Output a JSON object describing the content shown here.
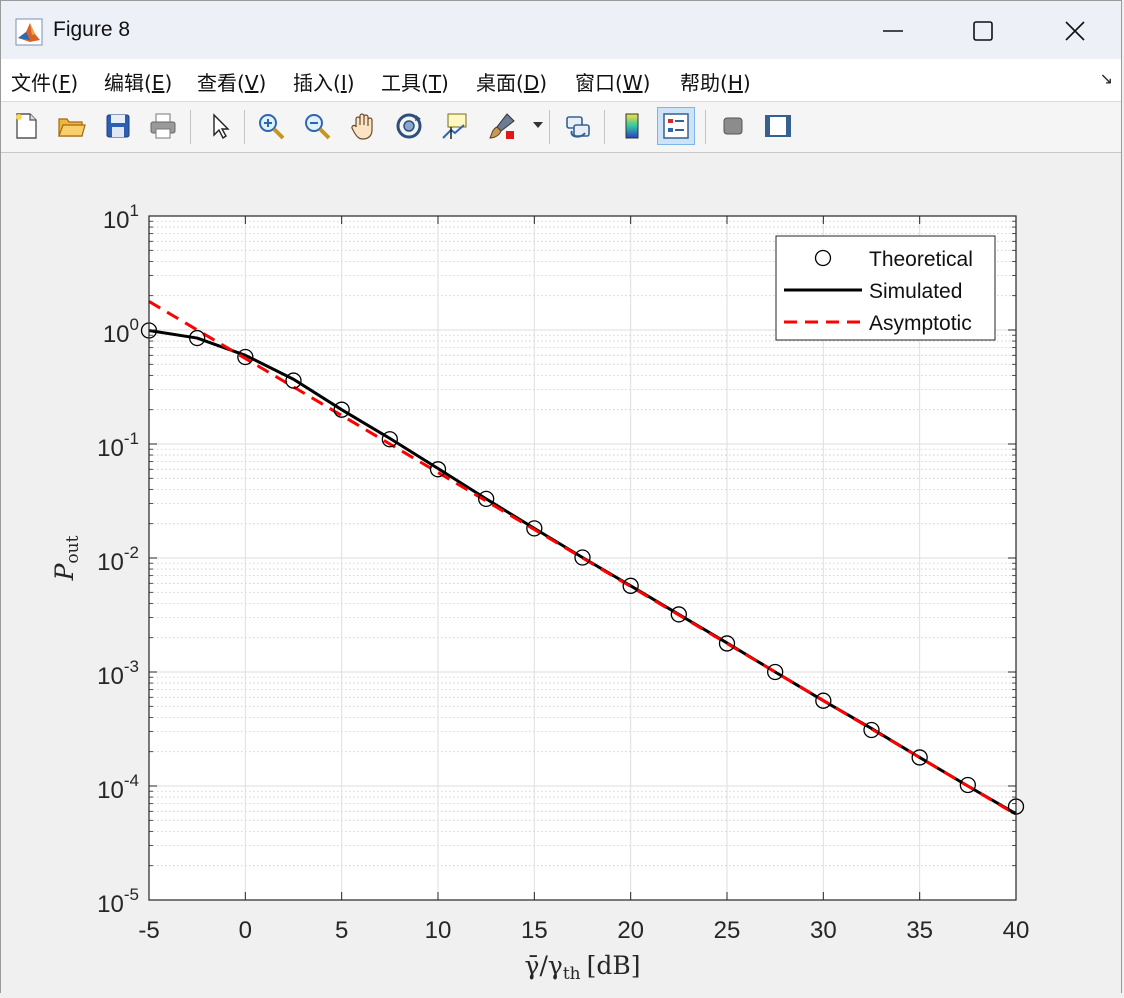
{
  "window": {
    "title": "Figure 8"
  },
  "menu": [
    {
      "label": "文件(",
      "key": "F",
      "tail": ")"
    },
    {
      "label": "编辑(",
      "key": "E",
      "tail": ")"
    },
    {
      "label": "查看(",
      "key": "V",
      "tail": ")"
    },
    {
      "label": "插入(",
      "key": "I",
      "tail": ")"
    },
    {
      "label": "工具(",
      "key": "T",
      "tail": ")"
    },
    {
      "label": "桌面(",
      "key": "D",
      "tail": ")"
    },
    {
      "label": "窗口(",
      "key": "W",
      "tail": ")"
    },
    {
      "label": "帮助(",
      "key": "H",
      "tail": ")"
    }
  ],
  "toolbar": [
    {
      "icon": "new-figure-icon"
    },
    {
      "icon": "open-file-icon"
    },
    {
      "icon": "save-icon"
    },
    {
      "icon": "print-icon"
    },
    {
      "icon": "pointer-icon"
    },
    {
      "icon": "zoom-in-icon"
    },
    {
      "icon": "zoom-out-icon"
    },
    {
      "icon": "pan-hand-icon"
    },
    {
      "icon": "rotate-3d-icon"
    },
    {
      "icon": "data-cursor-icon"
    },
    {
      "icon": "brush-icon"
    },
    {
      "icon": "link-plot-icon"
    },
    {
      "icon": "colorbar-icon"
    },
    {
      "icon": "legend-icon"
    },
    {
      "icon": "hide-plot-tools-icon"
    },
    {
      "icon": "show-plot-tools-icon"
    }
  ],
  "chart_data": {
    "type": "line",
    "x_label_parts": {
      "main": "γ̄/γ",
      "sub": "th",
      "unit": "[dB]"
    },
    "y_label_parts": {
      "main": "P",
      "sub": "out"
    },
    "xlim": [
      -5,
      40
    ],
    "ylim": [
      1e-05,
      10
    ],
    "yscale": "log",
    "grid": true,
    "minor_grid": true,
    "legend_position": "top-right",
    "x_ticks": [
      "-5",
      "0",
      "5",
      "10",
      "15",
      "20",
      "25",
      "30",
      "35",
      "40"
    ],
    "y_ticks": [
      {
        "base": "10",
        "exp": "1"
      },
      {
        "base": "10",
        "exp": "0"
      },
      {
        "base": "10",
        "exp": "-1"
      },
      {
        "base": "10",
        "exp": "-2"
      },
      {
        "base": "10",
        "exp": "-3"
      },
      {
        "base": "10",
        "exp": "-4"
      },
      {
        "base": "10",
        "exp": "-5"
      }
    ],
    "series": [
      {
        "name": "Theoretical",
        "style": "markers",
        "marker": "circle",
        "color": "#000000",
        "x": [
          -5,
          -2.5,
          0,
          2.5,
          5,
          7.5,
          10,
          12.5,
          15,
          17.5,
          20,
          22.5,
          25,
          27.5,
          30,
          32.5,
          35,
          37.5,
          40
        ],
        "y": [
          0.99,
          0.85,
          0.58,
          0.36,
          0.2,
          0.11,
          0.06,
          0.033,
          0.0182,
          0.0101,
          0.0057,
          0.0032,
          0.00178,
          0.001,
          0.00056,
          0.00031,
          0.000178,
          0.000102,
          6.6e-05
        ]
      },
      {
        "name": "Simulated",
        "style": "solid",
        "color": "#000000",
        "x": [
          -5,
          -2.5,
          0,
          2.5,
          5,
          7.5,
          10,
          12.5,
          15,
          17.5,
          20,
          22.5,
          25,
          27.5,
          30,
          32.5,
          35,
          37.5,
          40
        ],
        "y": [
          0.99,
          0.85,
          0.6,
          0.37,
          0.2,
          0.112,
          0.061,
          0.033,
          0.0182,
          0.0101,
          0.0057,
          0.0032,
          0.0018,
          0.001,
          0.00056,
          0.00032,
          0.000178,
          0.0001,
          5.7e-05
        ]
      },
      {
        "name": "Asymptotic",
        "style": "dashed",
        "color": "#ff0000",
        "x": [
          -5,
          40
        ],
        "y": [
          1.78,
          5.62e-05
        ]
      }
    ]
  }
}
